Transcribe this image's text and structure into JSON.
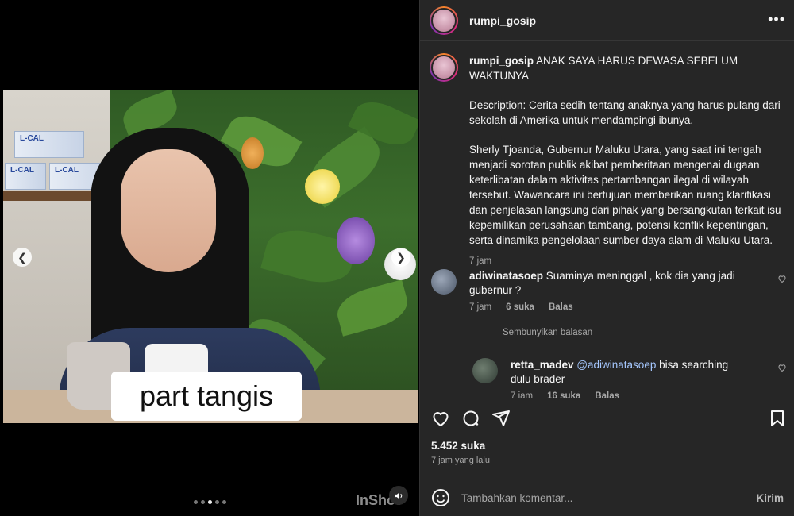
{
  "media": {
    "caption_overlay": "part tangis",
    "watermark": "InShot",
    "box_label": "L-CAL",
    "carousel": {
      "count": 5,
      "active_index": 2
    }
  },
  "post": {
    "author": "rumpi_gosip",
    "title": "ANAK SAYA HARUS DEWASA SEBELUM WAKTUNYA",
    "description": "Description: Cerita sedih tentang anaknya yang harus pulang dari sekolah di Amerika untuk mendampingi ibunya.",
    "body": "Sherly Tjoanda, Gubernur Maluku Utara, yang saat ini tengah menjadi sorotan publik akibat pemberitaan mengenai dugaan keterlibatan dalam aktivitas pertambangan ilegal di wilayah tersebut. Wawancara ini bertujuan memberikan ruang klarifikasi dan penjelasan langsung dari pihak yang bersangkutan terkait isu kepemilikan perusahaan tambang, potensi konflik kepentingan, serta dinamika pengelolaan sumber daya alam di Maluku Utara.",
    "time": "7 jam",
    "likes": "5.452 suka",
    "posted_ago": "7 jam yang lalu"
  },
  "comments": [
    {
      "user": "adiwinatasoep",
      "text": "Suaminya meninggal , kok dia yang jadi gubernur ?",
      "time": "7 jam",
      "likes": "6 suka",
      "reply_label": "Balas"
    }
  ],
  "hide_replies_label": "Sembunyikan balasan",
  "replies": [
    {
      "user": "retta_madev",
      "mention": "@adiwinatasoep",
      "text": "bisa searching dulu brader",
      "time": "7 jam",
      "likes": "16 suka",
      "reply_label": "Balas"
    }
  ],
  "composer": {
    "placeholder": "Tambahkan komentar...",
    "post_label": "Kirim"
  },
  "colors": {
    "panel_bg": "#262626",
    "text": "#f5f5f5",
    "muted": "#a8a8a8",
    "mention": "#a6c8ff"
  }
}
